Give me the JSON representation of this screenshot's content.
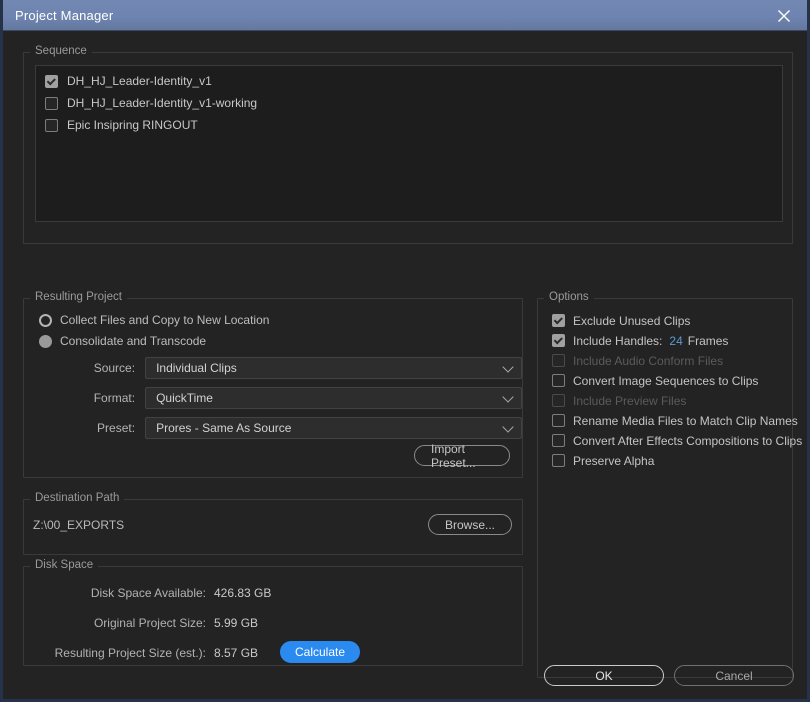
{
  "window": {
    "title": "Project Manager",
    "close_icon": "close-icon",
    "titlebar_color": "#6e84b0",
    "background_color": "#232323"
  },
  "sequence": {
    "legend": "Sequence",
    "items": [
      {
        "label": "DH_HJ_Leader-Identity_v1",
        "checked": true
      },
      {
        "label": "DH_HJ_Leader-Identity_v1-working",
        "checked": false
      },
      {
        "label": "Epic Insipring RINGOUT",
        "checked": false
      }
    ]
  },
  "resulting_project": {
    "legend": "Resulting Project",
    "radios": [
      {
        "label": "Collect Files and Copy to New Location",
        "selected": false
      },
      {
        "label": "Consolidate and Transcode",
        "selected": true
      }
    ],
    "fields": [
      {
        "label": "Source:",
        "value": "Individual Clips"
      },
      {
        "label": "Format:",
        "value": "QuickTime"
      },
      {
        "label": "Preset:",
        "value": "Prores - Same As Source"
      }
    ],
    "import_preset_label": "Import Preset..."
  },
  "options": {
    "legend": "Options",
    "items": [
      {
        "label": "Exclude Unused Clips",
        "checked": true,
        "disabled": false
      },
      {
        "label": "Include Handles:",
        "checked": true,
        "disabled": false,
        "value": "24",
        "unit": "Frames",
        "value_color": "#5c9ad2"
      },
      {
        "label": "Include Audio Conform Files",
        "checked": false,
        "disabled": true
      },
      {
        "label": "Convert Image Sequences to Clips",
        "checked": false,
        "disabled": false
      },
      {
        "label": "Include Preview Files",
        "checked": false,
        "disabled": true
      },
      {
        "label": "Rename Media Files to Match Clip Names",
        "checked": false,
        "disabled": false
      },
      {
        "label": "Convert After Effects Compositions to Clips",
        "checked": false,
        "disabled": false
      },
      {
        "label": "Preserve Alpha",
        "checked": false,
        "disabled": false
      }
    ]
  },
  "destination_path": {
    "legend": "Destination Path",
    "path": "Z:\\00_EXPORTS",
    "browse_label": "Browse..."
  },
  "disk_space": {
    "legend": "Disk Space",
    "rows": [
      {
        "label": "Disk Space Available:",
        "value": "426.83 GB"
      },
      {
        "label": "Original Project Size:",
        "value": "5.99 GB"
      },
      {
        "label": "Resulting Project Size (est.):",
        "value": "8.57 GB"
      }
    ],
    "calculate_label": "Calculate",
    "calculate_color": "#2a8af0"
  },
  "footer": {
    "ok_label": "OK",
    "cancel_label": "Cancel"
  }
}
